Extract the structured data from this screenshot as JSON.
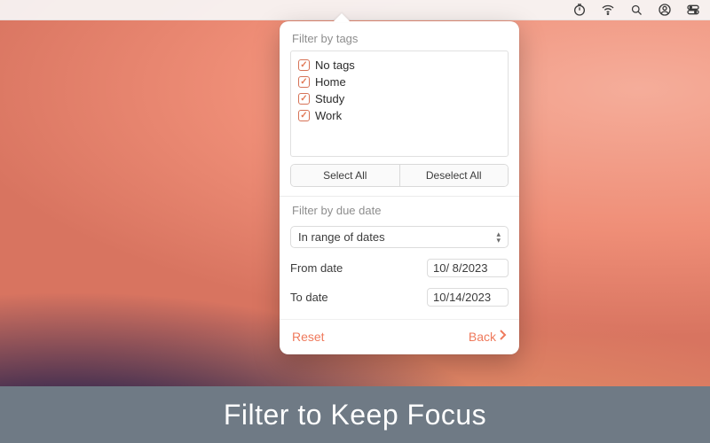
{
  "menubar": {
    "icons": [
      "timer-icon",
      "wifi-icon",
      "search-icon",
      "user-icon",
      "control-center-icon"
    ]
  },
  "popover": {
    "tags_section_label": "Filter by tags",
    "tags": [
      {
        "label": "No tags",
        "checked": true
      },
      {
        "label": "Home",
        "checked": true
      },
      {
        "label": "Study",
        "checked": true
      },
      {
        "label": "Work",
        "checked": true
      }
    ],
    "select_all_label": "Select All",
    "deselect_all_label": "Deselect All",
    "due_section_label": "Filter by due date",
    "range_select_value": "In range of dates",
    "from_label": "From date",
    "from_value": "10/  8/2023",
    "to_label": "To date",
    "to_value": "10/14/2023",
    "reset_label": "Reset",
    "back_label": "Back"
  },
  "caption": "Filter to Keep Focus",
  "colors": {
    "accent": "#ef7a5c"
  }
}
